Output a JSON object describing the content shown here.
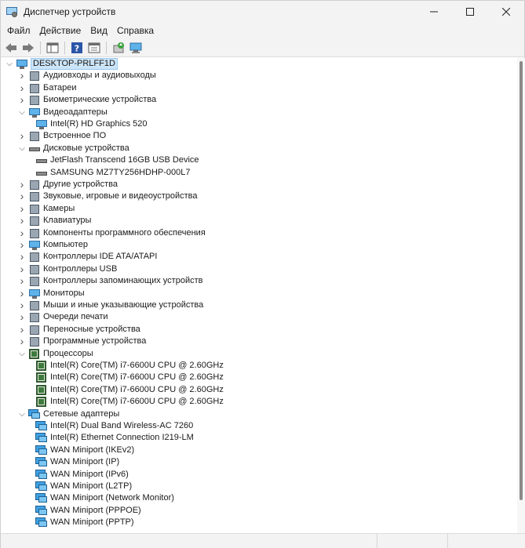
{
  "window": {
    "title": "Диспетчер устройств"
  },
  "menu": [
    "Файл",
    "Действие",
    "Вид",
    "Справка"
  ],
  "tree": {
    "root": "DESKTOP-PRLFF1D",
    "rows": [
      {
        "label": "Аудиовходы и аудиовыходы",
        "level": 1,
        "expand": "collapsed",
        "icon": "speaker-icon"
      },
      {
        "label": "Батареи",
        "level": 1,
        "expand": "collapsed",
        "icon": "battery-icon"
      },
      {
        "label": "Биометрические устройства",
        "level": 1,
        "expand": "collapsed",
        "icon": "fingerprint-icon"
      },
      {
        "label": "Видеоадаптеры",
        "level": 1,
        "expand": "expanded",
        "icon": "display-adapter-icon"
      },
      {
        "label": "Intel(R) HD Graphics 520",
        "level": 2,
        "expand": "none",
        "icon": "display-adapter-icon"
      },
      {
        "label": "Встроенное ПО",
        "level": 1,
        "expand": "collapsed",
        "icon": "firmware-icon"
      },
      {
        "label": "Дисковые устройства",
        "level": 1,
        "expand": "expanded",
        "icon": "disk-drive-icon"
      },
      {
        "label": "JetFlash Transcend 16GB USB Device",
        "level": 2,
        "expand": "none",
        "icon": "disk-drive-icon"
      },
      {
        "label": "SAMSUNG MZ7TY256HDHP-000L7",
        "level": 2,
        "expand": "none",
        "icon": "disk-drive-icon"
      },
      {
        "label": "Другие устройства",
        "level": 1,
        "expand": "collapsed",
        "icon": "unknown-device-icon"
      },
      {
        "label": "Звуковые, игровые и видеоустройства",
        "level": 1,
        "expand": "collapsed",
        "icon": "speaker-icon"
      },
      {
        "label": "Камеры",
        "level": 1,
        "expand": "collapsed",
        "icon": "camera-icon"
      },
      {
        "label": "Клавиатуры",
        "level": 1,
        "expand": "collapsed",
        "icon": "keyboard-icon"
      },
      {
        "label": "Компоненты программного обеспечения",
        "level": 1,
        "expand": "collapsed",
        "icon": "software-component-icon"
      },
      {
        "label": "Компьютер",
        "level": 1,
        "expand": "collapsed",
        "icon": "computer-icon"
      },
      {
        "label": "Контроллеры IDE ATA/ATAPI",
        "level": 1,
        "expand": "collapsed",
        "icon": "ide-controller-icon"
      },
      {
        "label": "Контроллеры USB",
        "level": 1,
        "expand": "collapsed",
        "icon": "usb-icon"
      },
      {
        "label": "Контроллеры запоминающих устройств",
        "level": 1,
        "expand": "collapsed",
        "icon": "storage-controller-icon"
      },
      {
        "label": "Мониторы",
        "level": 1,
        "expand": "collapsed",
        "icon": "monitor-icon"
      },
      {
        "label": "Мыши и иные указывающие устройства",
        "level": 1,
        "expand": "collapsed",
        "icon": "mouse-icon"
      },
      {
        "label": "Очереди печати",
        "level": 1,
        "expand": "collapsed",
        "icon": "printer-icon"
      },
      {
        "label": "Переносные устройства",
        "level": 1,
        "expand": "collapsed",
        "icon": "portable-device-icon"
      },
      {
        "label": "Программные устройства",
        "level": 1,
        "expand": "collapsed",
        "icon": "software-device-icon"
      },
      {
        "label": "Процессоры",
        "level": 1,
        "expand": "expanded",
        "icon": "processor-icon"
      },
      {
        "label": "Intel(R) Core(TM) i7-6600U CPU @ 2.60GHz",
        "level": 2,
        "expand": "none",
        "icon": "processor-icon"
      },
      {
        "label": "Intel(R) Core(TM) i7-6600U CPU @ 2.60GHz",
        "level": 2,
        "expand": "none",
        "icon": "processor-icon"
      },
      {
        "label": "Intel(R) Core(TM) i7-6600U CPU @ 2.60GHz",
        "level": 2,
        "expand": "none",
        "icon": "processor-icon"
      },
      {
        "label": "Intel(R) Core(TM) i7-6600U CPU @ 2.60GHz",
        "level": 2,
        "expand": "none",
        "icon": "processor-icon"
      },
      {
        "label": "Сетевые адаптеры",
        "level": 1,
        "expand": "expanded",
        "icon": "network-adapter-icon"
      },
      {
        "label": "Intel(R) Dual Band Wireless-AC 7260",
        "level": 2,
        "expand": "none",
        "icon": "network-adapter-icon"
      },
      {
        "label": "Intel(R) Ethernet Connection I219-LM",
        "level": 2,
        "expand": "none",
        "icon": "network-adapter-icon"
      },
      {
        "label": "WAN Miniport (IKEv2)",
        "level": 2,
        "expand": "none",
        "icon": "network-adapter-icon"
      },
      {
        "label": "WAN Miniport (IP)",
        "level": 2,
        "expand": "none",
        "icon": "network-adapter-icon"
      },
      {
        "label": "WAN Miniport (IPv6)",
        "level": 2,
        "expand": "none",
        "icon": "network-adapter-icon"
      },
      {
        "label": "WAN Miniport (L2TP)",
        "level": 2,
        "expand": "none",
        "icon": "network-adapter-icon"
      },
      {
        "label": "WAN Miniport (Network Monitor)",
        "level": 2,
        "expand": "none",
        "icon": "network-adapter-icon"
      },
      {
        "label": "WAN Miniport (PPPOE)",
        "level": 2,
        "expand": "none",
        "icon": "network-adapter-icon"
      },
      {
        "label": "WAN Miniport (PPTP)",
        "level": 2,
        "expand": "none",
        "icon": "network-adapter-icon"
      }
    ]
  },
  "colors": {
    "selection": "#cce4f7",
    "selection_border": "#99c9ef",
    "chrome": "#f3f3f3"
  }
}
